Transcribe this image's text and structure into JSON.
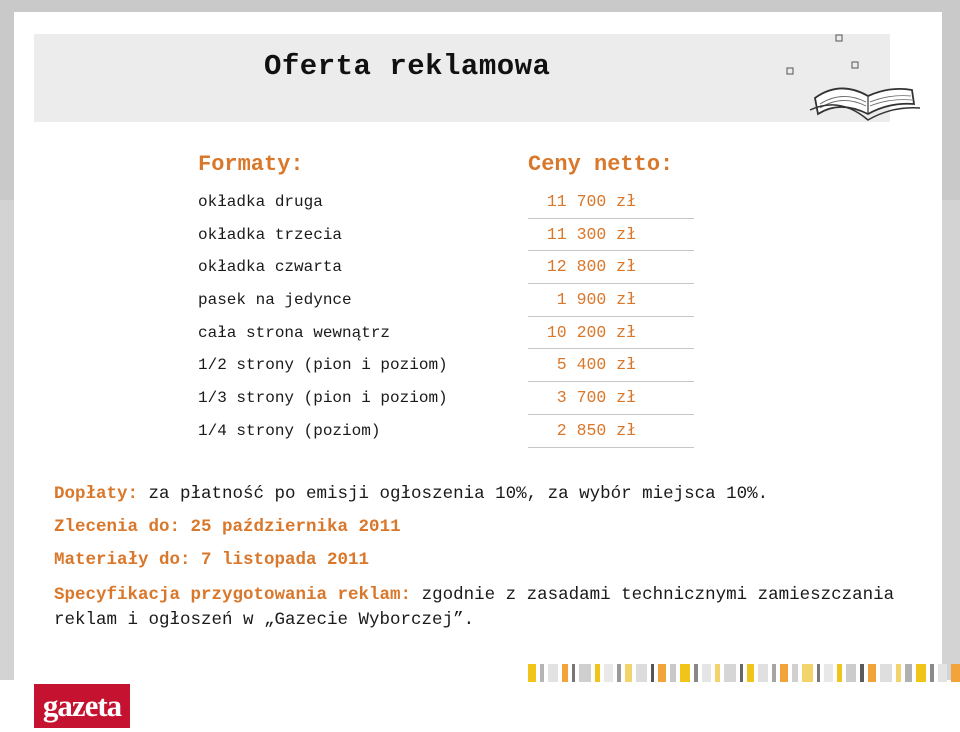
{
  "title": "Oferta reklamowa",
  "formats": {
    "heading": "Formaty:",
    "items": [
      "okładka druga",
      "okładka trzecia",
      "okładka czwarta",
      "pasek na jedynce",
      "cała strona wewnątrz",
      "1/2 strony (pion i poziom)",
      "1/3 strony (pion i poziom)",
      "1/4 strony (poziom)"
    ]
  },
  "prices": {
    "heading": "Ceny netto:",
    "items": [
      "11 700 zł",
      "11 300 zł",
      "12 800 zł",
      "1 900 zł",
      "10 200 zł",
      "5 400 zł",
      "3 700 zł",
      "2 850 zł"
    ]
  },
  "info": {
    "surcharges_label": "Dopłaty:",
    "surcharges_text": " za płatność po emisji ogłoszenia 10%, za wybór miejsca 10%.",
    "orders_label": "Zlecenia do:",
    "orders_value": "  25 października 2011",
    "materials_label": "Materiały do:",
    "materials_value": " 7 listopada 2011",
    "spec_label": "Specyfikacja przygotowania reklam:",
    "spec_text": " zgodnie z zasadami technicznymi zamieszczania reklam i ogłoszeń w „Gazecie Wyborczej”."
  },
  "logo": {
    "text": "gazeta",
    "color": "#c41230"
  },
  "colors": {
    "accent": "#d9772b",
    "text": "#1a1a1a"
  }
}
